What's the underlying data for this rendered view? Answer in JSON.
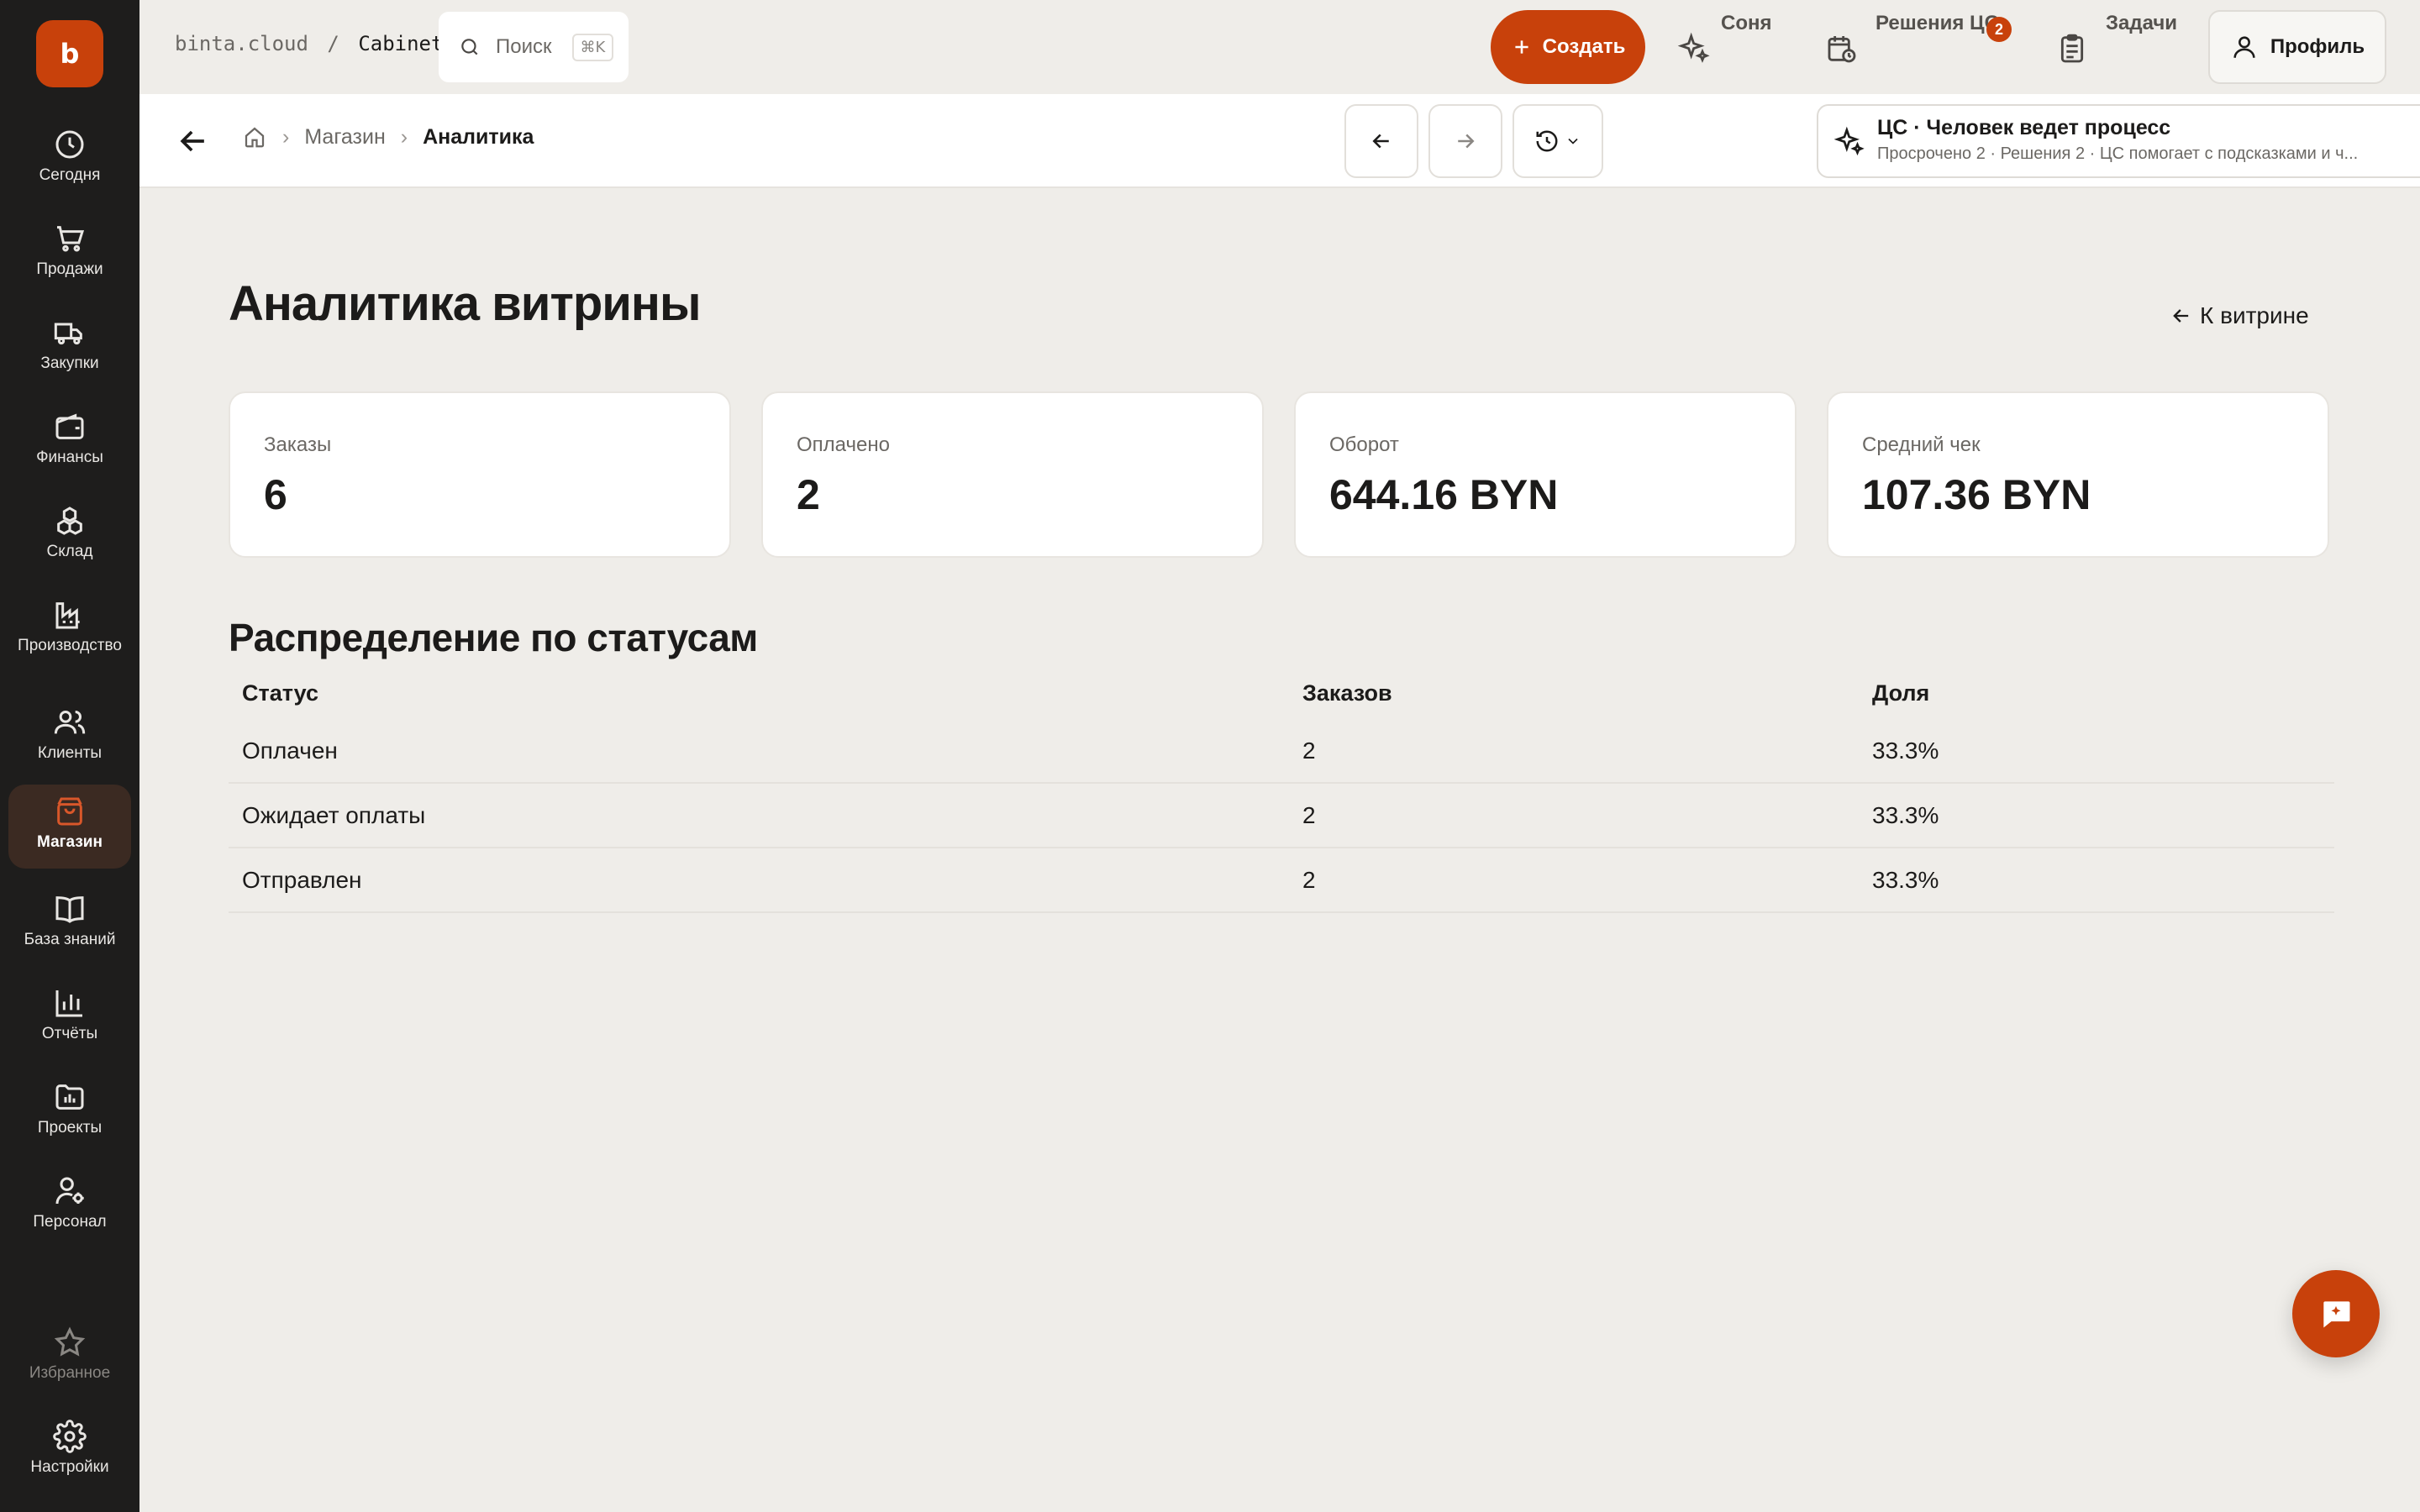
{
  "app": {
    "logo_letter": "b",
    "brand_color": "#c8410b"
  },
  "sidebar": {
    "items": [
      {
        "label": "Сегодня",
        "icon": "clock-icon"
      },
      {
        "label": "Продажи",
        "icon": "cart-icon"
      },
      {
        "label": "Закупки",
        "icon": "truck-icon"
      },
      {
        "label": "Финансы",
        "icon": "wallet-icon"
      },
      {
        "label": "Склад",
        "icon": "boxes-icon"
      },
      {
        "label": "Производство",
        "icon": "factory-icon"
      },
      {
        "label": "Клиенты",
        "icon": "users-icon"
      },
      {
        "label": "Магазин",
        "icon": "shopping-bag-icon",
        "active": true
      },
      {
        "label": "База знаний",
        "icon": "book-icon"
      },
      {
        "label": "Отчёты",
        "icon": "bar-chart-icon"
      },
      {
        "label": "Проекты",
        "icon": "folder-icon"
      },
      {
        "label": "Персонал",
        "icon": "user-settings-icon"
      }
    ],
    "favorites": "Избранное",
    "settings": "Настройки"
  },
  "topbar": {
    "host": "binta.cloud",
    "separator": "/",
    "cabinet": "Cabinet",
    "search_placeholder": "Поиск",
    "search_shortcut": "⌘K",
    "create_label": "Создать",
    "sonya_label": "Соня",
    "decisions_label": "Решения ЦС",
    "decisions_badge": "2",
    "tasks_label": "Задачи",
    "profile_label": "Профиль"
  },
  "subbar": {
    "breadcrumb": {
      "section": "Магазин",
      "current": "Аналитика"
    },
    "cs_title": "ЦС · Человек ведет процесс",
    "cs_subtitle": "Просрочено 2 · Решения 2 · ЦС помогает с подсказками и ч..."
  },
  "page": {
    "title": "Аналитика витрины",
    "back_link": "К витрине",
    "kpis": [
      {
        "label": "Заказы",
        "value": "6"
      },
      {
        "label": "Оплачено",
        "value": "2"
      },
      {
        "label": "Оборот",
        "value": "644.16 BYN"
      },
      {
        "label": "Средний чек",
        "value": "107.36 BYN"
      }
    ],
    "section_title": "Распределение по статусам",
    "table": {
      "headers": [
        "Статус",
        "Заказов",
        "Доля"
      ],
      "rows": [
        [
          "Оплачен",
          "2",
          "33.3%"
        ],
        [
          "Ожидает оплаты",
          "2",
          "33.3%"
        ],
        [
          "Отправлен",
          "2",
          "33.3%"
        ]
      ]
    }
  }
}
